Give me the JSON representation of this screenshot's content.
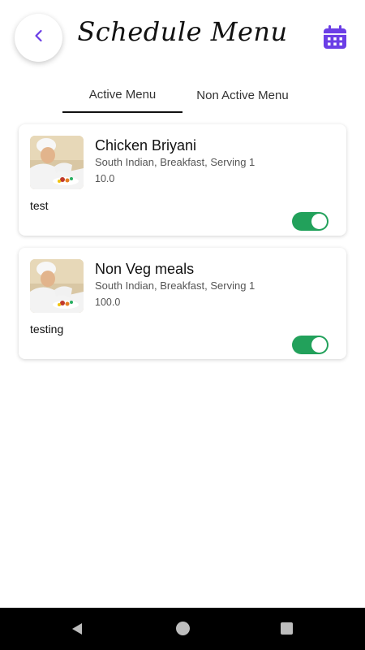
{
  "header": {
    "title": "Schedule Menu",
    "back_icon": "chevron-left-icon",
    "calendar_icon": "calendar-icon",
    "accent_color": "#6b3ee6"
  },
  "tabs": [
    {
      "label": "Active Menu",
      "active": true
    },
    {
      "label": "Non Active Menu",
      "active": false
    }
  ],
  "menu_items": [
    {
      "name": "Chicken Briyani",
      "meta": "South Indian, Breakfast, Serving 1",
      "price": "10.0",
      "note": "test",
      "active": true,
      "image_icon": "chef-photo"
    },
    {
      "name": "Non Veg meals",
      "meta": "South Indian, Breakfast, Serving 1",
      "price": "100.0",
      "note": "testing",
      "active": true,
      "image_icon": "chef-photo"
    }
  ],
  "colors": {
    "toggle_on": "#22a15b",
    "nav_bar": "#000000"
  },
  "system_nav": {
    "back_icon": "triangle-back-icon",
    "home_icon": "circle-home-icon",
    "recent_icon": "square-recents-icon"
  }
}
